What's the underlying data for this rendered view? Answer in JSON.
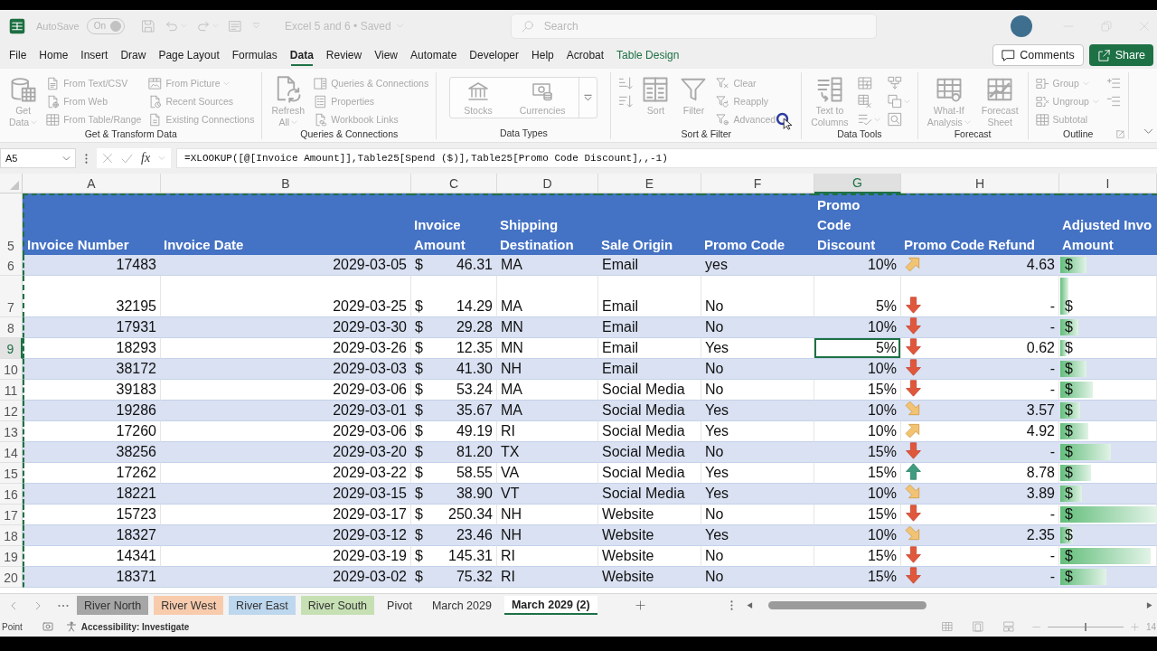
{
  "title_bar": {
    "autosave_label": "AutoSave",
    "autosave_toggle": {
      "label": "On",
      "on": true
    },
    "document_title": "Excel 5 and 6 • Saved",
    "search": {
      "placeholder": "Search"
    }
  },
  "menu_tabs": [
    {
      "label": "File",
      "kind": "standard",
      "selected": false
    },
    {
      "label": "Home",
      "kind": "standard",
      "selected": false
    },
    {
      "label": "Insert",
      "kind": "standard",
      "selected": false
    },
    {
      "label": "Draw",
      "kind": "standard",
      "selected": false
    },
    {
      "label": "Page Layout",
      "kind": "standard",
      "selected": false
    },
    {
      "label": "Formulas",
      "kind": "standard",
      "selected": false
    },
    {
      "label": "Data",
      "kind": "standard",
      "selected": true
    },
    {
      "label": "Review",
      "kind": "standard",
      "selected": false
    },
    {
      "label": "View",
      "kind": "standard",
      "selected": false
    },
    {
      "label": "Automate",
      "kind": "standard",
      "selected": false
    },
    {
      "label": "Developer",
      "kind": "standard",
      "selected": false
    },
    {
      "label": "Help",
      "kind": "standard",
      "selected": false
    },
    {
      "label": "Acrobat",
      "kind": "standard",
      "selected": false
    },
    {
      "label": "Table Design",
      "kind": "contextual",
      "selected": false
    }
  ],
  "header_buttons": [
    {
      "label": "Comments",
      "kind": "outline"
    },
    {
      "label": "Share",
      "kind": "primary"
    }
  ],
  "ribbon": {
    "groups": [
      {
        "label": "Get & Transform Data",
        "dialog_launcher": false,
        "columns": [
          {
            "kind": "large",
            "items": [
              {
                "lines": [
                  "Get",
                  "Data"
                ],
                "caret": true,
                "disabled": true
              }
            ]
          },
          {
            "kind": "small",
            "items": [
              {
                "label": "From Text/CSV",
                "caret": false,
                "disabled": true
              },
              {
                "label": "From Web",
                "caret": false,
                "disabled": true
              },
              {
                "label": "From Table/Range",
                "caret": false,
                "disabled": true
              }
            ]
          },
          {
            "kind": "small",
            "items": [
              {
                "label": "From Picture",
                "caret": true,
                "disabled": true
              },
              {
                "label": "Recent Sources",
                "caret": false,
                "disabled": true
              },
              {
                "label": "Existing Connections",
                "caret": false,
                "disabled": true
              }
            ]
          }
        ]
      },
      {
        "label": "Queries & Connections",
        "dialog_launcher": false,
        "columns": [
          {
            "kind": "large",
            "items": [
              {
                "lines": [
                  "Refresh",
                  "All"
                ],
                "caret": true,
                "disabled": true
              }
            ]
          },
          {
            "kind": "small",
            "items": [
              {
                "label": "Queries & Connections",
                "caret": false,
                "disabled": true
              },
              {
                "label": "Properties",
                "caret": false,
                "disabled": true
              },
              {
                "label": "Workbook Links",
                "caret": false,
                "disabled": true
              }
            ]
          }
        ]
      },
      {
        "label": "Data Types",
        "dialog_launcher": false,
        "columns": [
          {
            "kind": "gallery",
            "items": [
              {
                "label": "Stocks",
                "disabled": true
              },
              {
                "label": "Currencies",
                "disabled": true
              }
            ]
          }
        ]
      },
      {
        "label": "Sort & Filter",
        "dialog_launcher": false,
        "columns": [
          {
            "kind": "icons",
            "items": [
              {
                "caret": false,
                "disabled": true
              },
              {
                "caret": false,
                "disabled": true
              }
            ]
          },
          {
            "kind": "large",
            "items": [
              {
                "lines": [
                  "Sort"
                ],
                "caret": false,
                "disabled": true
              }
            ]
          },
          {
            "kind": "large",
            "items": [
              {
                "lines": [
                  "Filter"
                ],
                "caret": false,
                "disabled": true
              }
            ]
          },
          {
            "kind": "small",
            "items": [
              {
                "label": "Clear",
                "caret": false,
                "disabled": true
              },
              {
                "label": "Reapply",
                "caret": false,
                "disabled": true
              },
              {
                "label": "Advanced",
                "caret": false,
                "disabled": true
              }
            ]
          }
        ]
      },
      {
        "label": "Data Tools",
        "dialog_launcher": false,
        "columns": [
          {
            "kind": "large",
            "items": [
              {
                "lines": [
                  "Text to",
                  "Columns"
                ],
                "caret": false,
                "disabled": true
              }
            ]
          },
          {
            "kind": "icons",
            "items": [
              {
                "caret": false,
                "disabled": true
              },
              {
                "caret": false,
                "disabled": true
              },
              {
                "caret": true,
                "disabled": true
              }
            ]
          },
          {
            "kind": "icons",
            "items": [
              {
                "caret": false,
                "disabled": true
              },
              {
                "caret": true,
                "disabled": true
              },
              {
                "caret": false,
                "disabled": true
              }
            ]
          }
        ]
      },
      {
        "label": "Forecast",
        "dialog_launcher": false,
        "columns": [
          {
            "kind": "large",
            "items": [
              {
                "lines": [
                  "What-If",
                  "Analysis"
                ],
                "caret": true,
                "disabled": true
              }
            ]
          },
          {
            "kind": "large",
            "items": [
              {
                "lines": [
                  "Forecast",
                  "Sheet"
                ],
                "caret": false,
                "disabled": true
              }
            ]
          }
        ]
      },
      {
        "label": "Outline",
        "dialog_launcher": true,
        "columns": [
          {
            "kind": "small",
            "items": [
              {
                "label": "Group",
                "caret": true,
                "disabled": true
              },
              {
                "label": "Ungroup",
                "caret": true,
                "disabled": true
              },
              {
                "label": "Subtotal",
                "caret": false,
                "disabled": true
              }
            ]
          },
          {
            "kind": "icons",
            "items": [
              {
                "caret": false,
                "disabled": true
              },
              {
                "caret": false,
                "disabled": true
              }
            ]
          }
        ]
      }
    ]
  },
  "formula_bar": {
    "name_box": "A5",
    "function_label": "fx",
    "formula": "=XLOOKUP([@[Invoice Amount]],Table25[Spend ($)],Table25[Promo Code Discount],,-1)"
  },
  "sheet": {
    "copy_marquee": true,
    "columns": [
      {
        "letter": "A",
        "selected": false
      },
      {
        "letter": "B",
        "selected": false
      },
      {
        "letter": "C",
        "selected": false
      },
      {
        "letter": "D",
        "selected": false
      },
      {
        "letter": "E",
        "selected": false
      },
      {
        "letter": "F",
        "selected": false
      },
      {
        "letter": "G",
        "selected": true
      },
      {
        "letter": "H",
        "selected": false
      },
      {
        "letter": "I",
        "selected": false
      }
    ],
    "header_row": {
      "number": "5",
      "selected": false
    },
    "headers": [
      {
        "lines": [
          "Invoice Number"
        ]
      },
      {
        "lines": [
          "Invoice Date"
        ]
      },
      {
        "lines": [
          "Invoice",
          "Amount"
        ]
      },
      {
        "lines": [
          "Shipping",
          "Destination"
        ]
      },
      {
        "lines": [
          "Sale Origin"
        ]
      },
      {
        "lines": [
          "Promo Code"
        ]
      },
      {
        "lines": [
          "Promo",
          "Code",
          "Discount"
        ]
      },
      {
        "lines": [
          "Promo Code Refund"
        ]
      },
      {
        "lines": [
          "Adjusted Invo",
          "Amount"
        ]
      }
    ],
    "rows": [
      {
        "number": "6",
        "selected": false,
        "invoice_number": "17483",
        "invoice_date": "2029-03-05",
        "invoice_amount": {
          "symbol": "$",
          "value": "46.31"
        },
        "destination": "MA",
        "origin": "Email",
        "promo_code": "yes",
        "discount": "10%",
        "refund": {
          "kind": "up-right",
          "value": "4.63"
        },
        "adjusted": {
          "symbol": "$",
          "level": 0.27
        }
      },
      {
        "number": "7",
        "selected": false,
        "invoice_number": "32195",
        "invoice_date": "2029-03-25",
        "invoice_amount": {
          "symbol": "$",
          "value": "14.29"
        },
        "destination": "MA",
        "origin": "Email",
        "promo_code": "No",
        "discount": "5%",
        "refund": {
          "kind": "down",
          "value": "-"
        },
        "adjusted": {
          "symbol": "$",
          "level": 0.08
        }
      },
      {
        "number": "8",
        "selected": false,
        "invoice_number": "17931",
        "invoice_date": "2029-03-30",
        "invoice_amount": {
          "symbol": "$",
          "value": "29.28"
        },
        "destination": "MN",
        "origin": "Email",
        "promo_code": "No",
        "discount": "10%",
        "refund": {
          "kind": "down",
          "value": "-"
        },
        "adjusted": {
          "symbol": "$",
          "level": 0.19
        }
      },
      {
        "number": "9",
        "selected": true,
        "invoice_number": "18293",
        "invoice_date": "2029-03-26",
        "invoice_amount": {
          "symbol": "$",
          "value": "12.35"
        },
        "destination": "MN",
        "origin": "Email",
        "promo_code": "Yes",
        "discount": "5%",
        "refund": {
          "kind": "down",
          "value": "0.62"
        },
        "adjusted": {
          "symbol": "$",
          "level": 0.07
        }
      },
      {
        "number": "10",
        "selected": false,
        "invoice_number": "38172",
        "invoice_date": "2029-03-03",
        "invoice_amount": {
          "symbol": "$",
          "value": "41.30"
        },
        "destination": "NH",
        "origin": "Email",
        "promo_code": "No",
        "discount": "10%",
        "refund": {
          "kind": "down",
          "value": "-"
        },
        "adjusted": {
          "symbol": "$",
          "level": 0.27
        }
      },
      {
        "number": "11",
        "selected": false,
        "invoice_number": "39183",
        "invoice_date": "2029-03-06",
        "invoice_amount": {
          "symbol": "$",
          "value": "53.24"
        },
        "destination": "MA",
        "origin": "Social Media",
        "promo_code": "No",
        "discount": "15%",
        "refund": {
          "kind": "down",
          "value": "-"
        },
        "adjusted": {
          "symbol": "$",
          "level": 0.34
        }
      },
      {
        "number": "12",
        "selected": false,
        "invoice_number": "19286",
        "invoice_date": "2029-03-01",
        "invoice_amount": {
          "symbol": "$",
          "value": "35.67"
        },
        "destination": "MA",
        "origin": "Social Media",
        "promo_code": "Yes",
        "discount": "10%",
        "refund": {
          "kind": "down-right",
          "value": "3.57"
        },
        "adjusted": {
          "symbol": "$",
          "level": 0.21
        }
      },
      {
        "number": "13",
        "selected": false,
        "invoice_number": "17260",
        "invoice_date": "2029-03-06",
        "invoice_amount": {
          "symbol": "$",
          "value": "49.19"
        },
        "destination": "RI",
        "origin": "Social Media",
        "promo_code": "Yes",
        "discount": "10%",
        "refund": {
          "kind": "up-right",
          "value": "4.92"
        },
        "adjusted": {
          "symbol": "$",
          "level": 0.29
        }
      },
      {
        "number": "14",
        "selected": false,
        "invoice_number": "38256",
        "invoice_date": "2029-03-20",
        "invoice_amount": {
          "symbol": "$",
          "value": "81.20"
        },
        "destination": "TX",
        "origin": "Social Media",
        "promo_code": "No",
        "discount": "15%",
        "refund": {
          "kind": "down",
          "value": "-"
        },
        "adjusted": {
          "symbol": "$",
          "level": 0.52
        }
      },
      {
        "number": "15",
        "selected": false,
        "invoice_number": "17262",
        "invoice_date": "2029-03-22",
        "invoice_amount": {
          "symbol": "$",
          "value": "58.55"
        },
        "destination": "VA",
        "origin": "Social Media",
        "promo_code": "Yes",
        "discount": "15%",
        "refund": {
          "kind": "up",
          "value": "8.78"
        },
        "adjusted": {
          "symbol": "$",
          "level": 0.32
        }
      },
      {
        "number": "16",
        "selected": false,
        "invoice_number": "18221",
        "invoice_date": "2029-03-15",
        "invoice_amount": {
          "symbol": "$",
          "value": "38.90"
        },
        "destination": "VT",
        "origin": "Social Media",
        "promo_code": "Yes",
        "discount": "10%",
        "refund": {
          "kind": "down-right",
          "value": "3.89"
        },
        "adjusted": {
          "symbol": "$",
          "level": 0.22
        }
      },
      {
        "number": "17",
        "selected": false,
        "invoice_number": "15723",
        "invoice_date": "2029-03-17",
        "invoice_amount": {
          "symbol": "$",
          "value": "250.34"
        },
        "destination": "NH",
        "origin": "Website",
        "promo_code": "No",
        "discount": "15%",
        "refund": {
          "kind": "down",
          "value": "-"
        },
        "adjusted": {
          "symbol": "$",
          "level": 1
        }
      },
      {
        "number": "18",
        "selected": false,
        "invoice_number": "18327",
        "invoice_date": "2029-03-12",
        "invoice_amount": {
          "symbol": "$",
          "value": "23.46"
        },
        "destination": "NH",
        "origin": "Website",
        "promo_code": "Yes",
        "discount": "10%",
        "refund": {
          "kind": "down-right",
          "value": "2.35"
        },
        "adjusted": {
          "symbol": "$",
          "level": 0.13
        }
      },
      {
        "number": "19",
        "selected": false,
        "invoice_number": "14341",
        "invoice_date": "2029-03-19",
        "invoice_amount": {
          "symbol": "$",
          "value": "145.31"
        },
        "destination": "RI",
        "origin": "Website",
        "promo_code": "No",
        "discount": "15%",
        "refund": {
          "kind": "down",
          "value": "-"
        },
        "adjusted": {
          "symbol": "$",
          "level": 0.93
        }
      },
      {
        "number": "20",
        "selected": false,
        "invoice_number": "18371",
        "invoice_date": "2029-03-02",
        "invoice_amount": {
          "symbol": "$",
          "value": "75.32"
        },
        "destination": "RI",
        "origin": "Website",
        "promo_code": "No",
        "discount": "15%",
        "refund": {
          "kind": "down",
          "value": "-"
        },
        "adjusted": {
          "symbol": "$",
          "level": 0.48
        }
      }
    ]
  },
  "sheet_tabs": [
    {
      "label": "River North",
      "selected": false,
      "color": "#a6a6a6"
    },
    {
      "label": "River West",
      "selected": false,
      "color": "#f8cbad"
    },
    {
      "label": "River East",
      "selected": false,
      "color": "#bdd7ee"
    },
    {
      "label": "River South",
      "selected": false,
      "color": "#c6e0b4"
    },
    {
      "label": "Pivot",
      "selected": false
    },
    {
      "label": "March 2029",
      "selected": false
    },
    {
      "label": "March 2029 (2)",
      "selected": true
    }
  ],
  "status_bar": {
    "mode": "Point",
    "accessibility": "Accessibility: Investigate",
    "zoom": {
      "level": 0.5,
      "reading": "14"
    }
  }
}
